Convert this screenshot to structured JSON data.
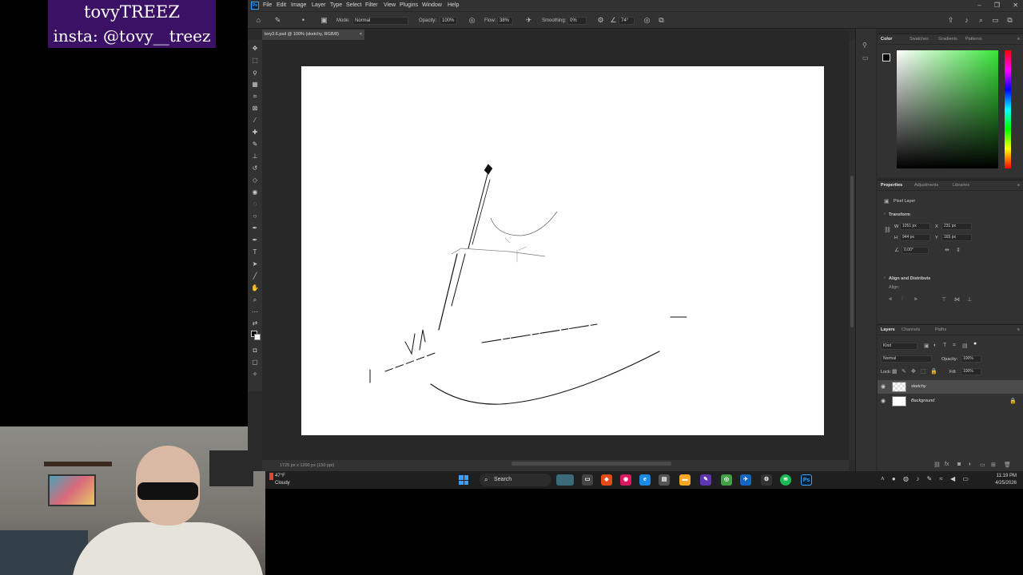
{
  "overlay": {
    "line1": "tovyTREEZ",
    "line2": "insta: @tovy__treez"
  },
  "menu": [
    "File",
    "Edit",
    "Image",
    "Layer",
    "Type",
    "Select",
    "Filter",
    "View",
    "Plugins",
    "Window",
    "Help"
  ],
  "window_controls": {
    "minimize": "–",
    "restore": "❐",
    "close": "✕"
  },
  "options": {
    "mode_label": "Mode:",
    "mode_value": "Normal",
    "opacity_label": "Opacity:",
    "opacity_value": "100%",
    "flow_label": "Flow:",
    "flow_value": "38%",
    "smoothing_label": "Smoothing:",
    "smoothing_value": "0%",
    "angle_value": "74°"
  },
  "document": {
    "tab_title": "tory3.6.psd @ 100% (sketchy, RGB/8)",
    "close": "×",
    "status": "1725 px x 1200 px (150 ppi)"
  },
  "panels": {
    "color_tabs": [
      "Color",
      "Swatches",
      "Gradients",
      "Patterns"
    ],
    "props_tabs": [
      "Properties",
      "Adjustments",
      "Libraries"
    ],
    "layers_tabs": [
      "Layers",
      "Channels",
      "Paths"
    ]
  },
  "properties": {
    "kind": "Pixel Layer",
    "transform_title": "Transform",
    "w_label": "W",
    "w_value": "1051 px",
    "h_label": "H",
    "h_value": "944 px",
    "x_label": "X",
    "x_value": "231 px",
    "y_label": "Y",
    "y_value": "165 px",
    "angle_value": "0.00°",
    "align_title": "Align and Distribute",
    "align_sub": "Align:"
  },
  "layers": {
    "filter_value": "Kind",
    "blend_value": "Normal",
    "opacity_label": "Opacity:",
    "opacity_value": "100%",
    "lock_label": "Lock:",
    "fill_label": "Fill:",
    "fill_value": "100%",
    "items": [
      {
        "name": "sketchy",
        "selected": true
      },
      {
        "name": "Background",
        "selected": false
      }
    ]
  },
  "taskbar": {
    "temp": "47°F",
    "weather": "Cloudy",
    "search": "Search",
    "time": "11:19 PM",
    "date": "4/25/2026"
  },
  "colors": {
    "ps_accent": "#31a8ff",
    "banner_bg": "#3b1166",
    "fg_color": "#000000",
    "bg_color": "#ffffff"
  }
}
